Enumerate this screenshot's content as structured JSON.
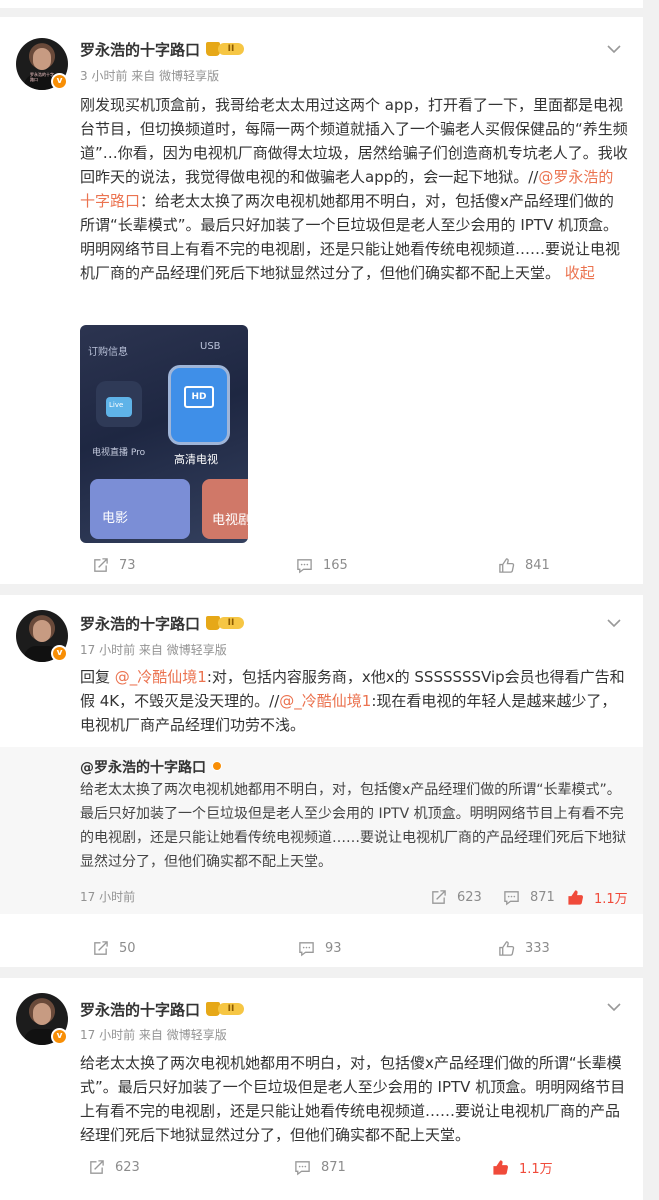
{
  "posts": [
    {
      "author": "罗永浩的十字路口",
      "level": "II",
      "time": "3 小时前",
      "source_prefix": "来自",
      "source": "微博轻享版",
      "text_a": "刚发现买机顶盒前，我哥给老太太用过这两个 app，打开看了一下，里面都是电视台节目，但切换频道时，每隔一两个频道就插入了一个骗老人买假保健品的“养生频道”…你看，因为电视机厂商做得太垃圾，居然给骗子们创造商机专坑老人了。我收回昨天的说法，我觉得做电视的和做骗老人app的，会一起下地狱。//",
      "mention": "@罗永浩的十字路口",
      "text_b": "：给老太太换了两次电视机她都用不明白，对，包括傻x产品经理们做的所谓“长辈模式”。最后只好加装了一个巨垃圾但是老人至少会用的 IPTV 机顶盒。明明网络节目上有看不完的电视剧，还是只能让她看传统电视频道……要说让电视机厂商的产品经理们死后下地狱显然过分了，但他们确实都不配上天堂。 ",
      "collapse": "收起",
      "image": {
        "label_order": "订购信息",
        "label_usb": "USB",
        "app1_badge": "Live",
        "app1": "电视直播 Pro",
        "app2_badge": "HD",
        "app2": "高清电视",
        "tile1": "电影",
        "tile2": "电视剧"
      },
      "reposts": "73",
      "comments": "165",
      "likes": "841"
    },
    {
      "author": "罗永浩的十字路口",
      "level": "II",
      "time": "17 小时前",
      "source_prefix": "来自",
      "source": "微博轻享版",
      "reply_prefix": "回复 ",
      "mention1": "@_冷酷仙境1",
      "text_a": ":对，包括内容服务商，x他x的 SSSSSSSVip会员也得看广告和假 4K，不毁灭是没天理的。//",
      "mention2": "@_冷酷仙境1",
      "text_b": ":现在看电视的年轻人是越来越少了，电视机厂商产品经理们功劳不浅。",
      "quote": {
        "author": "@罗永浩的十字路口",
        "text": "给老太太换了两次电视机她都用不明白，对，包括傻x产品经理们做的所谓“长辈模式”。最后只好加装了一个巨垃圾但是老人至少会用的 IPTV 机顶盒。明明网络节目上有看不完的电视剧，还是只能让她看传统电视频道……要说让电视机厂商的产品经理们死后下地狱显然过分了，但他们确实都不配上天堂。",
        "time": "17 小时前",
        "reposts": "623",
        "comments": "871",
        "likes": "1.1万"
      },
      "reposts": "50",
      "comments": "93",
      "likes": "333"
    },
    {
      "author": "罗永浩的十字路口",
      "level": "II",
      "time": "17 小时前",
      "source_prefix": "来自",
      "source": "微博轻享版",
      "text": "给老太太换了两次电视机她都用不明白，对，包括傻x产品经理们做的所谓“长辈模式”。最后只好加装了一个巨垃圾但是老人至少会用的 IPTV 机顶盒。明明网络节目上有看不完的电视剧，还是只能让她看传统电视频道……要说让电视机厂商的产品经理们死后下地狱显然过分了，但他们确实都不配上天堂。",
      "reposts": "623",
      "comments": "871",
      "likes": "1.1万"
    }
  ],
  "avatar_caption": "罗永浩的十字路口",
  "colors": {
    "link": "#eb7350",
    "liked": "#f04a3a",
    "verified": "#f88e05"
  }
}
